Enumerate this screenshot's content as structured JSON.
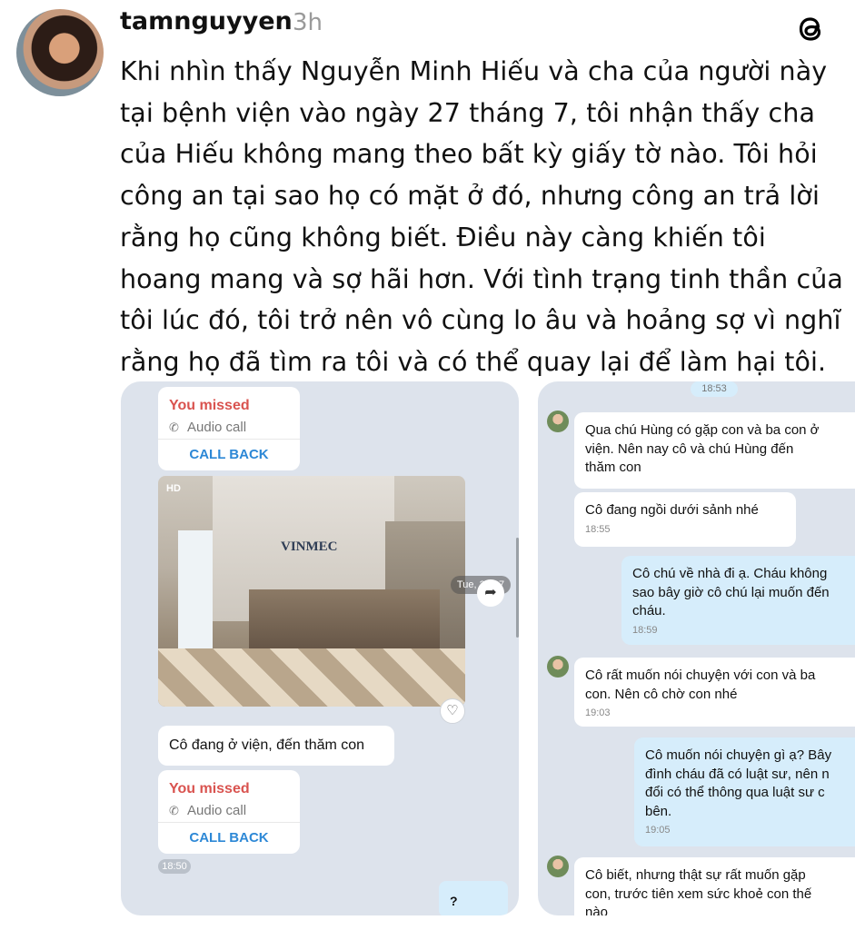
{
  "post": {
    "username": "tamnguyyen",
    "time": "3h",
    "text_lines": [
      "Khi nhìn thấy Nguyễn Minh Hiếu và cha của người này",
      "tại bệnh viện vào ngày 27 tháng 7, tôi nhận thấy cha",
      "của Hiếu không mang theo bất kỳ giấy tờ nào. Tôi hỏi",
      "công an tại sao họ có mặt ở đó, nhưng công an trả lời",
      "rằng họ cũng không biết. Điều này càng khiến tôi",
      "hoang mang và sợ hãi hơn. Với tình trạng tinh thần của",
      "tôi lúc đó, tôi trở nên vô cùng lo âu và hoảng sợ vì nghĩ",
      "rằng họ đã tìm ra tôi và có thể quay lại để làm hại tôi."
    ],
    "icons": {
      "logo": "threads-logo-icon",
      "avatar": "user-avatar"
    }
  },
  "left_chat": {
    "missed_call_1": {
      "title": "You missed",
      "type": "Audio call",
      "action": "CALL BACK"
    },
    "photo": {
      "hd_badge": "HD",
      "sign": "VINMEC",
      "date": "Tue, 28/07"
    },
    "message": "Cô đang ở viện, đến thăm con",
    "missed_call_2": {
      "title": "You missed",
      "type": "Audio call",
      "action": "CALL BACK"
    },
    "time_chip": "18:50",
    "question_bubble": "?"
  },
  "right_chat": {
    "top_time": "18:53",
    "messages": [
      {
        "dir": "in",
        "lines": [
          "Qua chú Hùng có gặp con và ba con ở",
          "viện. Nên nay cô và chú Hùng đến",
          "thăm con"
        ],
        "time": ""
      },
      {
        "dir": "in",
        "lines": [
          "Cô đang ngồi dưới sảnh nhé"
        ],
        "time": "18:55"
      },
      {
        "dir": "out",
        "lines": [
          "Cô chú về nhà đi ạ. Cháu không",
          "sao bây giờ cô chú lại muốn đến",
          "cháu."
        ],
        "time": "18:59"
      },
      {
        "dir": "in",
        "lines": [
          "Cô rất muốn nói chuyện với con và ba",
          "con. Nên cô chờ con nhé"
        ],
        "time": "19:03"
      },
      {
        "dir": "out",
        "lines": [
          "Cô muốn nói chuyện gì ạ? Bây",
          "đình cháu đã có luật sư, nên n",
          "đổi có thể thông qua luật sư c",
          "bên."
        ],
        "time": "19:05"
      },
      {
        "dir": "in",
        "lines": [
          "Cô biết, nhưng thật sự rất muốn gặp",
          "con, trước tiên xem sức khoẻ con thế",
          "nào"
        ],
        "time": ""
      }
    ]
  },
  "colors": {
    "missed": "#d9534f",
    "callback": "#2d88d6",
    "chat_bg": "#dde3ec",
    "outgoing": "#d6edfb"
  }
}
